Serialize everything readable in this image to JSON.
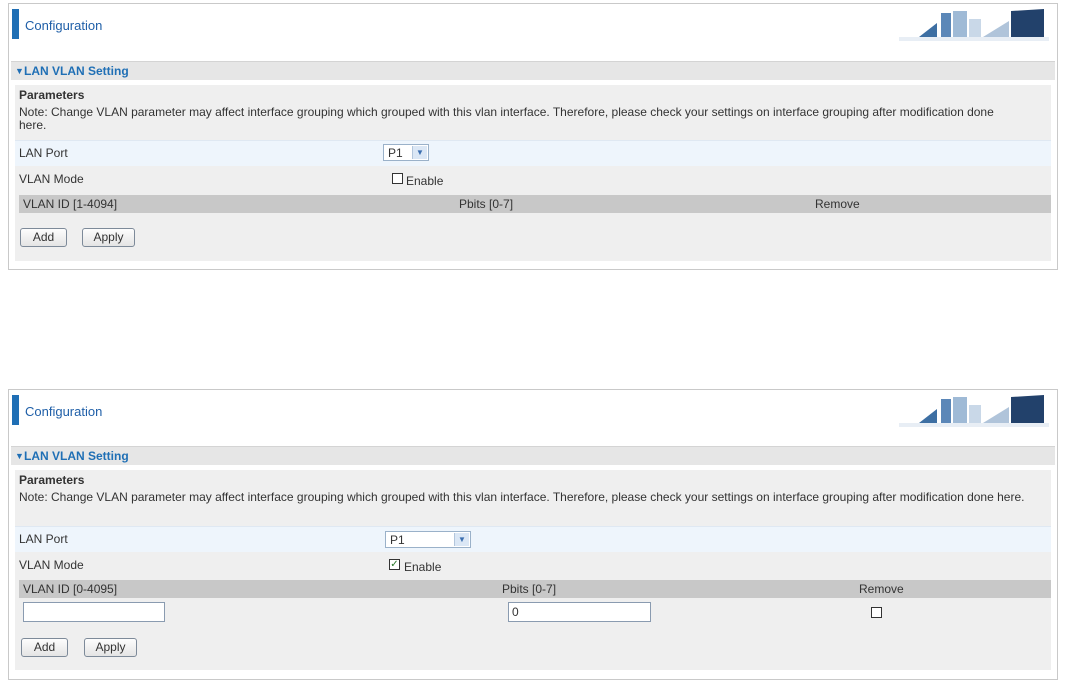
{
  "panels": [
    {
      "header_title": "Configuration",
      "section_title": "LAN VLAN Setting",
      "params_title": "Parameters",
      "note": "Note: Change VLAN parameter may affect interface grouping which grouped with this vlan interface. Therefore, please check your settings on interface grouping after modification done here.",
      "lan_port_label": "LAN Port",
      "lan_port_value": "P1",
      "vlan_mode_label": "VLAN Mode",
      "enable_label": "Enable",
      "enable_checked": false,
      "col_vlan_id": "VLAN ID [1-4094]",
      "col_pbits": "Pbits [0-7]",
      "col_remove": "Remove",
      "add_label": "Add",
      "apply_label": "Apply"
    },
    {
      "header_title": "Configuration",
      "section_title": "LAN VLAN Setting",
      "params_title": "Parameters",
      "note": "Note: Change VLAN parameter may affect interface grouping which grouped with this vlan interface. Therefore, please check your settings on interface grouping after modification done here.",
      "lan_port_label": "LAN Port",
      "lan_port_value": "P1",
      "vlan_mode_label": "VLAN Mode",
      "enable_label": "Enable",
      "enable_checked": true,
      "col_vlan_id": "VLAN ID [0-4095]",
      "col_pbits": "Pbits [0-7]",
      "col_remove": "Remove",
      "row_vlan_id_value": "",
      "row_pbits_value": "0",
      "row_remove_checked": false,
      "add_label": "Add",
      "apply_label": "Apply"
    }
  ],
  "icons": {
    "section_toggle": "triangle-down-icon",
    "select_arrow": "chevron-down-icon",
    "logo": "network-devices-logo"
  },
  "colors": {
    "accent": "#1f6fb5",
    "section_bg": "#e6e6e6",
    "table_header_bg": "#c8c8c8"
  }
}
